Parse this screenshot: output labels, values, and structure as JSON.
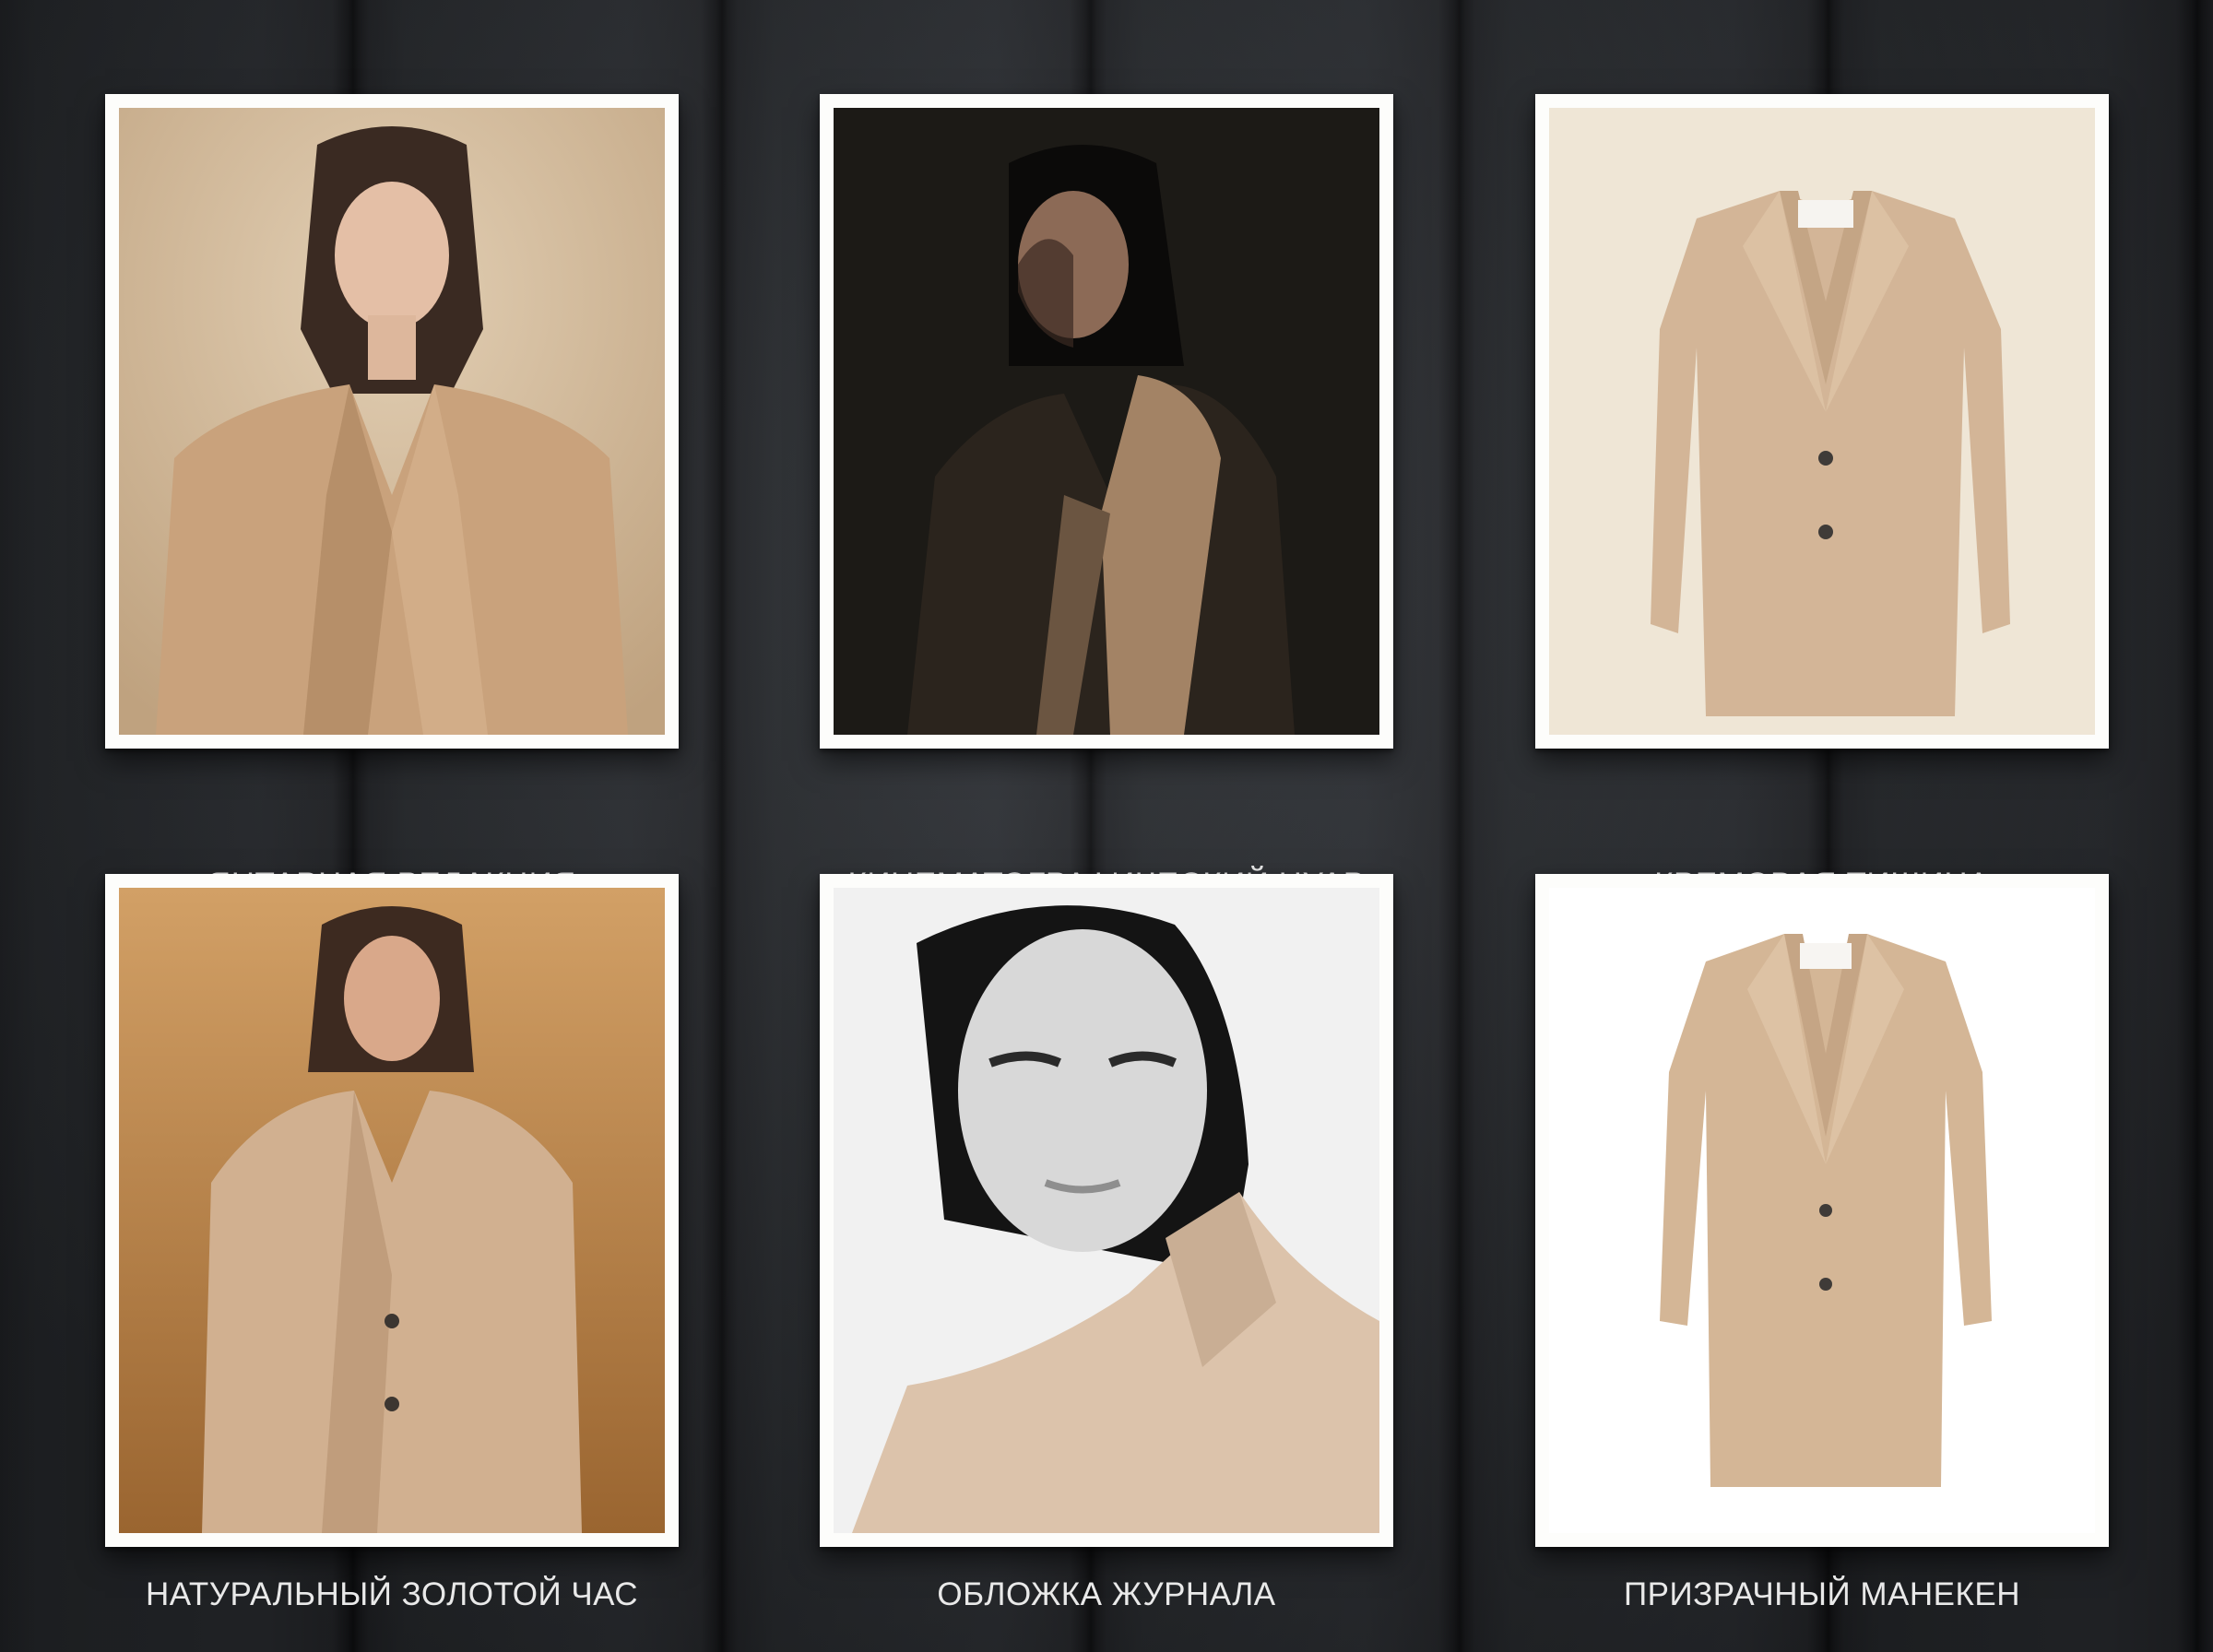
{
  "gallery": {
    "items": [
      {
        "caption": "ЯНТАРНАЯ РЕДАКЦИЯ",
        "style": "studio-warm",
        "background": "#d8c2a4"
      },
      {
        "caption": "КИНЕМАТОГРАФИЧЕСКИЙ НУАР",
        "style": "dark-noir",
        "background": "#1c1a16"
      },
      {
        "caption": "КРЕМОВАЯ ТИШИНА",
        "style": "flat-lay-cream",
        "background": "#efe6d6"
      },
      {
        "caption": "НАТУРАЛЬНЫЙ ЗОЛОТОЙ ЧАС",
        "style": "golden-field",
        "background": "#c18a48"
      },
      {
        "caption": "ОБЛОЖКА ЖУРНАЛА",
        "style": "monochrome-closeup",
        "background": "#f1f1f1"
      },
      {
        "caption": "ПРИЗРАЧНЫЙ МАНЕКЕН",
        "style": "ghost-mannequin-white",
        "background": "#ffffff"
      }
    ],
    "coat_color": "#cfae8c"
  }
}
